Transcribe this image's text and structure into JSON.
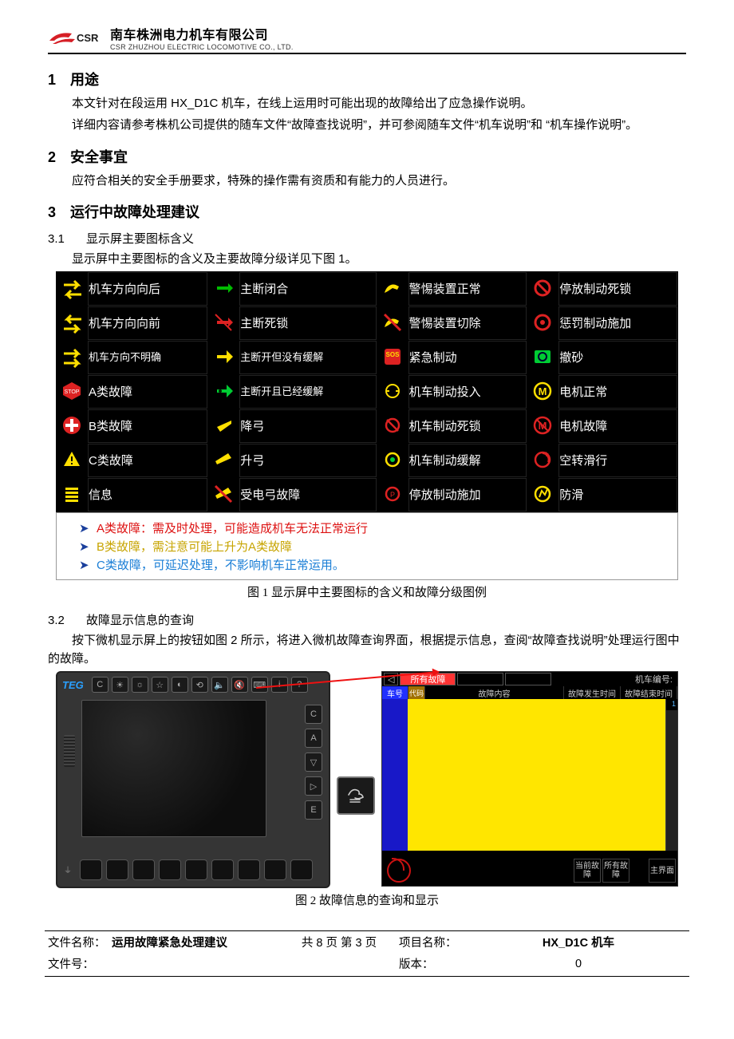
{
  "header": {
    "company_cn": "南车株洲电力机车有限公司",
    "company_en": "CSR ZHUZHOU ELECTRIC LOCOMOTIVE CO., LTD."
  },
  "section1": {
    "num": "1",
    "title": "用途",
    "p1": "本文针对在段运用 HX_D1C 机车，在线上运用时可能出现的故障给出了应急操作说明。",
    "p2": "详细内容请参考株机公司提供的随车文件“故障查找说明”，并可参阅随车文件“机车说明”和 “机车操作说明”。"
  },
  "section2": {
    "num": "2",
    "title": "安全事宜",
    "p1": "应符合相关的安全手册要求，特殊的操作需有资质和有能力的人员进行。"
  },
  "section3": {
    "num": "3",
    "title": "运行中故障处理建议",
    "sub31_num": "3.1",
    "sub31_title": "显示屏主要图标含义",
    "sub31_p": "显示屏中主要图标的含义及主要故障分级详见下图 1。",
    "sub32_num": "3.2",
    "sub32_title": "故障显示信息的查询",
    "sub32_p": "按下微机显示屏上的按钮如图 2 所示，将进入微机故障查询界面，根据提示信息，查阅“故障查找说明”处理运行图中的故障。"
  },
  "icon_table": {
    "rows": [
      [
        "机车方向向后",
        "主断闭合",
        "警惕装置正常",
        "停放制动死锁"
      ],
      [
        "机车方向向前",
        "主断死锁",
        "警惕装置切除",
        "惩罚制动施加"
      ],
      [
        "机车方向不明确",
        "主断开但没有缓解",
        "紧急制动",
        "撤砂"
      ],
      [
        "A类故障",
        "主断开且已经缓解",
        "机车制动投入",
        "电机正常"
      ],
      [
        "B类故障",
        "降弓",
        "机车制动死锁",
        "电机故障"
      ],
      [
        "C类故障",
        "升弓",
        "机车制动缓解",
        "空转滑行"
      ],
      [
        "信息",
        "受电弓故障",
        "停放制动施加",
        "防滑"
      ]
    ],
    "legend": [
      {
        "cls": "a",
        "text": "A类故障：需及时处理，可能造成机车无法正常运行"
      },
      {
        "cls": "b",
        "text": "B类故障，需注意可能上升为A类故障"
      },
      {
        "cls": "c",
        "text": "C类故障，可延迟处理，不影响机车正常运用。"
      }
    ],
    "caption": "图 1  显示屏中主要图标的含义和故障分级图例"
  },
  "fig2": {
    "panel_logo": "TEG",
    "top_buttons": [
      "C",
      "☀",
      "☼",
      "☆",
      "◐",
      "⟲",
      "🔈",
      "🔇",
      "⌨",
      "i",
      "?"
    ],
    "right_buttons": [
      "C",
      "A",
      "▽",
      "▷",
      "E"
    ],
    "callout_glyph": "✎☰",
    "screen": {
      "back": "◁",
      "tab_active": "所有故障",
      "right_label": "机车编号:",
      "head": [
        "车号",
        "代码",
        "故障内容",
        "故障发生时间",
        "故障结束时间"
      ],
      "scroll_num": "1",
      "btn_cur": "当前故障",
      "btn_all": "所有故障",
      "btn_main": "主界面"
    },
    "caption": "图 2  故障信息的查询和显示"
  },
  "footer": {
    "file_name_label": "文件名称：",
    "file_name": "运用故障紧急处理建议",
    "page": "共 8 页  第 3 页",
    "proj_label": "项目名称：",
    "proj": "HX_D1C 机车",
    "fileno_label": "文件号：",
    "ver_label": "版本：",
    "ver": "0"
  }
}
